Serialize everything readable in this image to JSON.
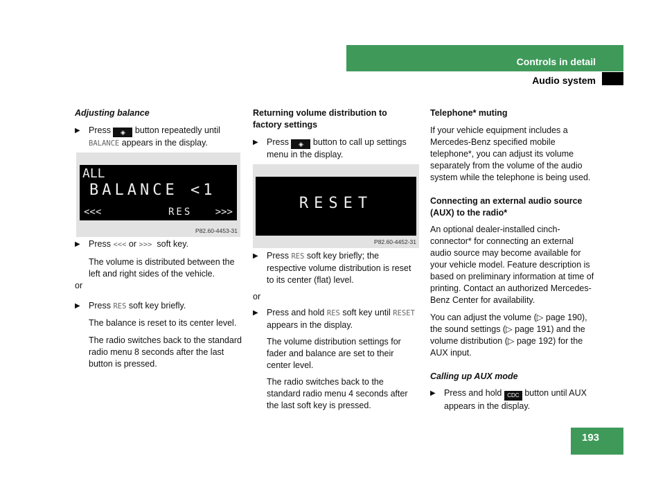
{
  "header": {
    "section": "Controls in detail",
    "subsection": "Audio system",
    "page_number": "193",
    "accent_color": "#3f9a5a"
  },
  "col1": {
    "title": "Adjusting balance",
    "step1_a": "Press",
    "step1_icon": "settings-button-icon",
    "step1_b": "button repeatedly until",
    "step1_mono": "BALANCE",
    "step1_c": "appears in the display.",
    "figure": {
      "line1": "ALL",
      "line2": "BALANCE <1",
      "softkeys": [
        "<<<",
        "RES",
        ">>>"
      ],
      "caption": "P82.60-4453-31"
    },
    "step2_a": "Press",
    "step2_k1": "<<<",
    "step2_or": "or",
    "step2_k2": ">>>",
    "step2_b": "soft key.",
    "step2_text": "The volume is distributed between the left and right sides of the vehicle.",
    "or": "or",
    "step3_a": "Press",
    "step3_mono": "RES",
    "step3_b": "soft key briefly.",
    "step3_text1": "The balance is reset to its center level.",
    "step3_text2": "The radio switches back to the standard radio menu 8 seconds after the last button is pressed."
  },
  "col2": {
    "title": "Returning volume distribution to factory settings",
    "step1_a": "Press",
    "step1_b": "button to call up settings menu in the display.",
    "figure": {
      "line": "RESET",
      "caption": "P82.60-4452-31"
    },
    "step2_a": "Press",
    "step2_mono": "RES",
    "step2_b": "soft key briefly; the respective volume distribution is reset to its center (flat) level.",
    "or": "or",
    "step3_a": "Press and hold",
    "step3_mono": "RES",
    "step3_b": "soft key until",
    "step3_mono2": "RESET",
    "step3_c": "appears in the display.",
    "step3_text1": "The volume distribution settings for fader and balance are set to their center level.",
    "step3_text2": "The radio switches back to the standard radio menu 4 seconds after the last soft key is pressed."
  },
  "col3": {
    "title1": "Telephone* muting",
    "p1": "If your vehicle equipment includes a Mercedes-Benz specified mobile telephone*, you can adjust its volume separately from the volume of the audio system while the telephone is being used.",
    "title2": "Connecting an external audio source (AUX) to the radio*",
    "p2": "An optional dealer-installed cinch-connector* for connecting an external audio source may become available for your vehicle model. Feature description is based on preliminary information at time of printing. Contact an authorized Mercedes-Benz Center for availability.",
    "p3": "You can adjust the volume (▷ page 190), the sound settings (▷ page 191) and the volume distribution (▷ page 192) for the AUX input.",
    "title3": "Calling up AUX mode",
    "step_a": "Press and hold",
    "step_btn": "CDC",
    "step_b": "button until AUX appears in the display."
  }
}
